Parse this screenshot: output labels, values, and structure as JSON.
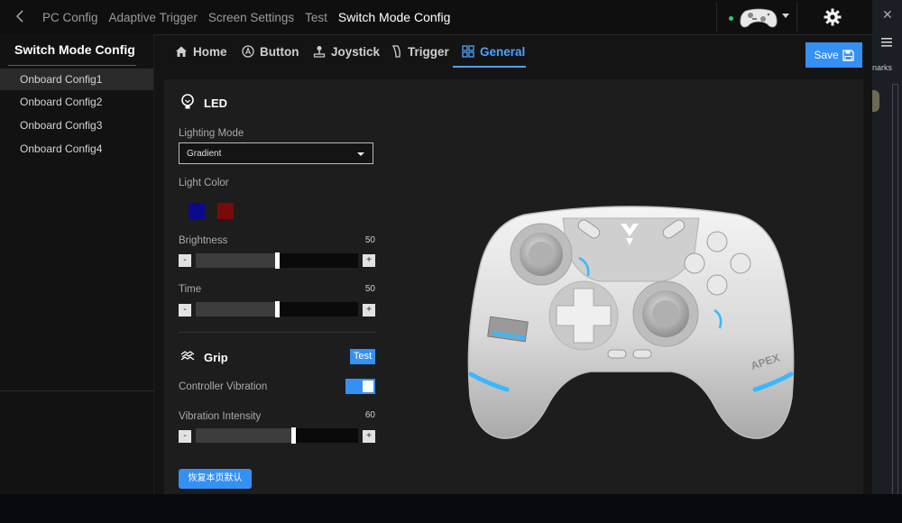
{
  "breadcrumbs": [
    "PC Config",
    "Adaptive Trigger",
    "Screen Settings",
    "Test"
  ],
  "current_page": "Switch Mode Config",
  "sidebar": {
    "title": "Switch Mode Config",
    "items": [
      "Onboard Config1",
      "Onboard Config2",
      "Onboard Config3",
      "Onboard Config4"
    ],
    "active_index": 0
  },
  "tabs": [
    {
      "label": "Home",
      "icon": "home-icon"
    },
    {
      "label": "Button",
      "icon": "button-a-icon"
    },
    {
      "label": "Joystick",
      "icon": "joystick-icon"
    },
    {
      "label": "Trigger",
      "icon": "trigger-icon"
    },
    {
      "label": "General",
      "icon": "grid-icon"
    }
  ],
  "active_tab": "General",
  "save_label": "Save",
  "led": {
    "title": "LED",
    "lighting_mode_label": "Lighting Mode",
    "lighting_mode_value": "Gradient",
    "light_color_label": "Light Color",
    "colors": [
      "#0a0a8a",
      "#7a0a0a"
    ],
    "brightness_label": "Brightness",
    "brightness_value": "50",
    "brightness_max": 100,
    "time_label": "Time",
    "time_value": "50",
    "time_max": 100
  },
  "grip": {
    "title": "Grip",
    "test_label": "Test",
    "controller_vibration_label": "Controller Vibration",
    "controller_vibration_on": true,
    "vibration_intensity_label": "Vibration Intensity",
    "vibration_intensity_value": "60",
    "vibration_intensity_max": 100
  },
  "reset_label": "恢复本页默认",
  "controller_brand": "APEX",
  "right_strip_text": "narks",
  "colors": {
    "accent": "#3590f3",
    "tab_active": "#4da3ff",
    "status_online": "#2ecc71",
    "controller_glow": "#39b8ff"
  }
}
